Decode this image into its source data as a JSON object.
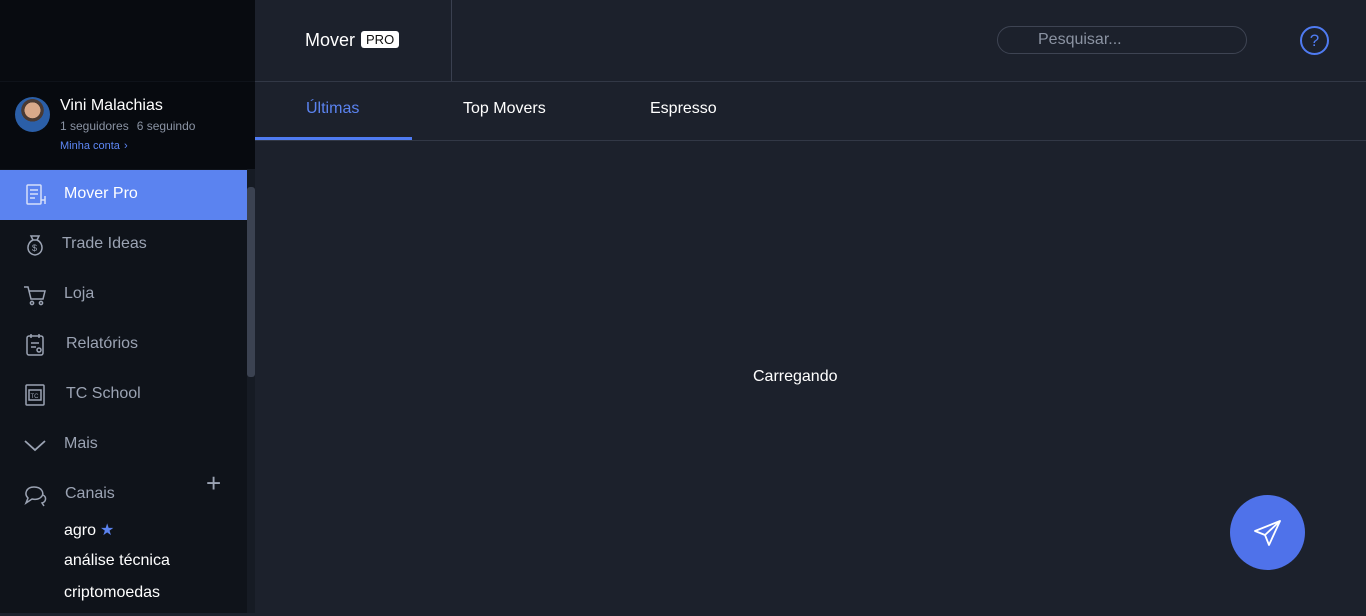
{
  "header": {
    "brand": "Mover",
    "badge": "PRO",
    "search_placeholder": "Pesquisar...",
    "help_icon": "?"
  },
  "profile": {
    "name": "Vini Malachias",
    "followers": "1 seguidores",
    "following": "6 seguindo",
    "account_link": "Minha conta"
  },
  "sidebar": {
    "items": [
      {
        "label": "Mover Pro",
        "icon": "document-icon"
      },
      {
        "label": "Trade Ideas",
        "icon": "money-bag-icon"
      },
      {
        "label": "Loja",
        "icon": "cart-icon"
      },
      {
        "label": "Relatórios",
        "icon": "report-icon"
      },
      {
        "label": "TC School",
        "icon": "school-icon"
      },
      {
        "label": "Mais",
        "icon": "chevron-down-icon"
      },
      {
        "label": "Canais",
        "icon": "chat-icon"
      }
    ],
    "channels": [
      "agro",
      "análise técnica",
      "criptomoedas"
    ]
  },
  "tabs": [
    "Últimas",
    "Top Movers",
    "Espresso"
  ],
  "main": {
    "status": "Carregando"
  },
  "colors": {
    "accent": "#5b83f0",
    "background": "#1c212c",
    "sidebar": "#0f131a"
  }
}
